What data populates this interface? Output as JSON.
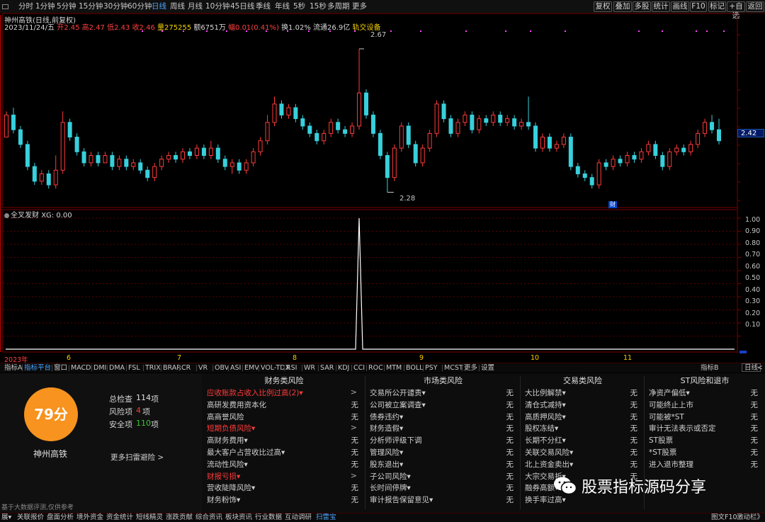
{
  "periods": [
    "分时",
    "1分钟",
    "5分钟",
    "15分钟",
    "30分钟",
    "60分钟",
    "日线",
    "周线",
    "月线",
    "10分钟",
    "45日线",
    "季线",
    "年线",
    "5秒",
    "15秒",
    "多周期",
    "更多"
  ],
  "active_period": "日线",
  "right_tools": [
    "复权",
    "叠加",
    "多股",
    "统计",
    "画线",
    "F10",
    "标记",
    "+自选",
    "返回"
  ],
  "stock_title": "神州高铁(日线,前复权)",
  "info": {
    "date": "2023/11/24/五",
    "open": "开2.45",
    "high": "高2.47",
    "low": "低2.43",
    "close": "收2.46",
    "volume": "量275255",
    "amount": "额6751万",
    "change": "幅0.01(0.41%)",
    "turnover": "换1.02%",
    "float_cap": "流通26.9亿",
    "sector": "轨交设备"
  },
  "price_tag": "2.42",
  "cai_tag": "财",
  "annotations": {
    "high": "2.67",
    "low": "2.28"
  },
  "indicator": {
    "title": "全叉发财",
    "value": "XG: 0.00"
  },
  "y_axis_indicator": [
    "1.00",
    "0.90",
    "0.80",
    "0.70",
    "0.60",
    "0.50",
    "0.40",
    "0.30",
    "0.20",
    "0.10"
  ],
  "x_dates": [
    "2023年",
    "6",
    "7",
    "8",
    "9",
    "10",
    "11"
  ],
  "indicator_tabs": [
    "指标A",
    "指标平台",
    "窗口",
    "MACD",
    "DMI",
    "DMA",
    "FSL",
    "TRIX",
    "BRAR",
    "CR",
    "VR",
    "OBV",
    "ASI",
    "EMV",
    "VOL-TDX",
    "RSI",
    "WR",
    "SAR",
    "KDJ",
    "CCI",
    "ROC",
    "MTM",
    "BOLL",
    "PSY",
    "MCST",
    "更多",
    "设置"
  ],
  "indicator_tabs_active": "指标平台",
  "indicator_right": [
    "指标B",
    "日线",
    "+",
    "<"
  ],
  "score": {
    "value": "79分",
    "company": "神州高铁",
    "total_label": "总检查",
    "total": "114",
    "total_unit": "项",
    "risk_label": "风险项",
    "risk": "4",
    "risk_unit": "项",
    "safe_label": "安全项",
    "safe": "110",
    "safe_unit": "项",
    "more": "更多扫雷避险 >"
  },
  "panel_note": "基于大数据评测,仅供参考",
  "risk_columns": [
    {
      "title": "财务类风险",
      "rows": [
        {
          "label": "应收账款占收入比例过高(2)▾",
          "status": ">",
          "hot": true
        },
        {
          "label": "高研发费用资本化",
          "status": "无",
          "hot": false
        },
        {
          "label": "高商誉风险",
          "status": "无",
          "hot": false
        },
        {
          "label": "短期负债风险▾",
          "status": ">",
          "hot": true
        },
        {
          "label": "高财务费用▾",
          "status": "无",
          "hot": false
        },
        {
          "label": "最大客户占营收比过高▾",
          "status": "无",
          "hot": false
        },
        {
          "label": "流动性风险▾",
          "status": "无",
          "hot": false
        },
        {
          "label": "财报亏损▾",
          "status": ">",
          "hot": true
        },
        {
          "label": "营收陡降风险▾",
          "status": "无",
          "hot": false
        },
        {
          "label": "财务粉饰▾",
          "status": "无",
          "hot": false
        }
      ]
    },
    {
      "title": "市场类风险",
      "rows": [
        {
          "label": "交易所公开谴责▾",
          "status": "无",
          "hot": false
        },
        {
          "label": "公司被立案调查▾",
          "status": "无",
          "hot": false
        },
        {
          "label": "债券违约▾",
          "status": "无",
          "hot": false
        },
        {
          "label": "财务造假▾",
          "status": "无",
          "hot": false
        },
        {
          "label": "分析师评级下调",
          "status": "无",
          "hot": false
        },
        {
          "label": "管理风险▾",
          "status": "无",
          "hot": false
        },
        {
          "label": "股东退出▾",
          "status": "无",
          "hot": false
        },
        {
          "label": "子公司风险▾",
          "status": "无",
          "hot": false
        },
        {
          "label": "长时间停牌▾",
          "status": "无",
          "hot": false
        },
        {
          "label": "审计报告保留意见▾",
          "status": "无",
          "hot": false
        }
      ]
    },
    {
      "title": "交易类风险",
      "rows": [
        {
          "label": "大比例解禁▾",
          "status": "无",
          "hot": false
        },
        {
          "label": "清仓式减持▾",
          "status": "无",
          "hot": false
        },
        {
          "label": "高质押风险▾",
          "status": "无",
          "hot": false
        },
        {
          "label": "股权冻结▾",
          "status": "无",
          "hot": false
        },
        {
          "label": "长期不分红▾",
          "status": "无",
          "hot": false
        },
        {
          "label": "关联交易风险▾",
          "status": "无",
          "hot": false
        },
        {
          "label": "北上资金卖出▾",
          "status": "无",
          "hot": false
        },
        {
          "label": "大宗交易折▾",
          "status": "无",
          "hot": false
        },
        {
          "label": "融券高额▾",
          "status": "",
          "hot": false
        },
        {
          "label": "换手率过高▾",
          "status": "",
          "hot": false
        }
      ]
    },
    {
      "title": "ST风险和退市",
      "rows": [
        {
          "label": "净资产偏低▾",
          "status": "无",
          "hot": false
        },
        {
          "label": "可能终止上市",
          "status": "无",
          "hot": false
        },
        {
          "label": "可能被*ST",
          "status": "无",
          "hot": false
        },
        {
          "label": "审计无法表示或否定",
          "status": "无",
          "hot": false
        },
        {
          "label": "ST股票",
          "status": "无",
          "hot": false
        },
        {
          "label": "*ST股票",
          "status": "无",
          "hot": false
        },
        {
          "label": "进入退市整理",
          "status": "无",
          "hot": false
        }
      ]
    }
  ],
  "watermark": "股票指标源码分享",
  "status_tabs": [
    "展▾",
    "关联报价",
    "盘面分析",
    "境外资金",
    "资金统计",
    "短线精灵",
    "涨跌贡献",
    "综合资讯",
    "板块资讯",
    "行业数据",
    "互动调研",
    "扫雷宝"
  ],
  "status_tabs_active": "扫雷宝",
  "status_right": [
    "图文F10",
    "激动栏》"
  ],
  "colors": {
    "up": "#ff3b3b",
    "down": "#37d0dc",
    "accent": "#4da6ff",
    "score": "#f7931e"
  },
  "chart_data": {
    "type": "candlestick",
    "note_series": "daily candles, price",
    "candles": [
      [
        2.43,
        2.49,
        2.5,
        2.43
      ],
      [
        2.49,
        2.45,
        2.51,
        2.44
      ],
      [
        2.45,
        2.41,
        2.46,
        2.4
      ],
      [
        2.41,
        2.35,
        2.42,
        2.34
      ],
      [
        2.35,
        2.31,
        2.36,
        2.3
      ],
      [
        2.31,
        2.33,
        2.34,
        2.3
      ],
      [
        2.33,
        2.3,
        2.34,
        2.29
      ],
      [
        2.3,
        2.34,
        2.38,
        2.29
      ],
      [
        2.34,
        2.47,
        2.5,
        2.33
      ],
      [
        2.47,
        2.43,
        2.48,
        2.42
      ],
      [
        2.43,
        2.39,
        2.44,
        2.38
      ],
      [
        2.39,
        2.36,
        2.4,
        2.35
      ],
      [
        2.36,
        2.38,
        2.39,
        2.35
      ],
      [
        2.38,
        2.36,
        2.39,
        2.35
      ],
      [
        2.36,
        2.38,
        2.39,
        2.36
      ],
      [
        2.38,
        2.35,
        2.39,
        2.34
      ],
      [
        2.35,
        2.37,
        2.38,
        2.34
      ],
      [
        2.37,
        2.35,
        2.38,
        2.34
      ],
      [
        2.35,
        2.36,
        2.37,
        2.34
      ],
      [
        2.36,
        2.34,
        2.37,
        2.33
      ],
      [
        2.34,
        2.32,
        2.35,
        2.31
      ],
      [
        2.32,
        2.35,
        2.36,
        2.31
      ],
      [
        2.35,
        2.37,
        2.38,
        2.34
      ],
      [
        2.37,
        2.38,
        2.39,
        2.36
      ],
      [
        2.38,
        2.37,
        2.39,
        2.36
      ],
      [
        2.37,
        2.39,
        2.4,
        2.36
      ],
      [
        2.39,
        2.38,
        2.4,
        2.37
      ],
      [
        2.38,
        2.4,
        2.41,
        2.37
      ],
      [
        2.4,
        2.38,
        2.41,
        2.37
      ],
      [
        2.38,
        2.4,
        2.42,
        2.37
      ],
      [
        2.4,
        2.37,
        2.41,
        2.36
      ],
      [
        2.37,
        2.35,
        2.38,
        2.34
      ],
      [
        2.35,
        2.36,
        2.37,
        2.33
      ],
      [
        2.36,
        2.34,
        2.37,
        2.33
      ],
      [
        2.34,
        2.36,
        2.37,
        2.33
      ],
      [
        2.36,
        2.39,
        2.4,
        2.35
      ],
      [
        2.39,
        2.42,
        2.43,
        2.38
      ],
      [
        2.42,
        2.47,
        2.49,
        2.41
      ],
      [
        2.47,
        2.52,
        2.54,
        2.46
      ],
      [
        2.52,
        2.49,
        2.53,
        2.48
      ],
      [
        2.49,
        2.51,
        2.52,
        2.48
      ],
      [
        2.51,
        2.48,
        2.52,
        2.47
      ],
      [
        2.48,
        2.46,
        2.49,
        2.45
      ],
      [
        2.46,
        2.44,
        2.47,
        2.43
      ],
      [
        2.44,
        2.42,
        2.45,
        2.41
      ],
      [
        2.42,
        2.44,
        2.45,
        2.41
      ],
      [
        2.44,
        2.47,
        2.48,
        2.43
      ],
      [
        2.47,
        2.45,
        2.48,
        2.44
      ],
      [
        2.45,
        2.44,
        2.46,
        2.43
      ],
      [
        2.44,
        2.46,
        2.47,
        2.43
      ],
      [
        2.46,
        2.55,
        2.67,
        2.45
      ],
      [
        2.55,
        2.49,
        2.56,
        2.48
      ],
      [
        2.49,
        2.44,
        2.5,
        2.43
      ],
      [
        2.44,
        2.38,
        2.45,
        2.37
      ],
      [
        2.38,
        2.32,
        2.39,
        2.28
      ],
      [
        2.32,
        2.4,
        2.41,
        2.31
      ],
      [
        2.4,
        2.46,
        2.47,
        2.39
      ],
      [
        2.46,
        2.41,
        2.47,
        2.4
      ],
      [
        2.41,
        2.36,
        2.42,
        2.35
      ],
      [
        2.36,
        2.4,
        2.41,
        2.35
      ],
      [
        2.4,
        2.44,
        2.45,
        2.39
      ],
      [
        2.44,
        2.52,
        2.53,
        2.43
      ],
      [
        2.52,
        2.48,
        2.53,
        2.47
      ],
      [
        2.48,
        2.44,
        2.49,
        2.43
      ],
      [
        2.44,
        2.47,
        2.48,
        2.43
      ],
      [
        2.47,
        2.49,
        2.5,
        2.46
      ],
      [
        2.49,
        2.45,
        2.5,
        2.44
      ],
      [
        2.45,
        2.48,
        2.49,
        2.44
      ],
      [
        2.48,
        2.47,
        2.49,
        2.46
      ],
      [
        2.47,
        2.49,
        2.5,
        2.46
      ],
      [
        2.49,
        2.47,
        2.5,
        2.46
      ],
      [
        2.47,
        2.48,
        2.49,
        2.46
      ],
      [
        2.48,
        2.46,
        2.49,
        2.45
      ],
      [
        2.46,
        2.47,
        2.48,
        2.45
      ],
      [
        2.47,
        2.46,
        2.54,
        2.45
      ],
      [
        2.46,
        2.4,
        2.47,
        2.39
      ],
      [
        2.4,
        2.43,
        2.44,
        2.39
      ],
      [
        2.43,
        2.4,
        2.44,
        2.39
      ],
      [
        2.4,
        2.41,
        2.42,
        2.39
      ],
      [
        2.41,
        2.43,
        2.44,
        2.4
      ],
      [
        2.43,
        2.35,
        2.44,
        2.34
      ],
      [
        2.35,
        2.33,
        2.36,
        2.32
      ],
      [
        2.33,
        2.32,
        2.34,
        2.31
      ],
      [
        2.32,
        2.3,
        2.33,
        2.29
      ],
      [
        2.3,
        2.36,
        2.37,
        2.29
      ],
      [
        2.36,
        2.35,
        2.37,
        2.34
      ],
      [
        2.35,
        2.37,
        2.38,
        2.34
      ],
      [
        2.37,
        2.36,
        2.38,
        2.35
      ],
      [
        2.36,
        2.38,
        2.39,
        2.35
      ],
      [
        2.38,
        2.37,
        2.39,
        2.36
      ],
      [
        2.37,
        2.39,
        2.4,
        2.36
      ],
      [
        2.39,
        2.41,
        2.42,
        2.38
      ],
      [
        2.41,
        2.38,
        2.42,
        2.37
      ],
      [
        2.38,
        2.35,
        2.39,
        2.34
      ],
      [
        2.35,
        2.39,
        2.4,
        2.34
      ],
      [
        2.39,
        2.4,
        2.41,
        2.38
      ],
      [
        2.4,
        2.39,
        2.41,
        2.38
      ],
      [
        2.39,
        2.41,
        2.42,
        2.38
      ],
      [
        2.41,
        2.44,
        2.45,
        2.4
      ],
      [
        2.44,
        2.47,
        2.48,
        2.43
      ],
      [
        2.47,
        2.45,
        2.49,
        2.44
      ],
      [
        2.45,
        2.42,
        2.48,
        2.41
      ]
    ],
    "ylim": [
      2.25,
      2.72
    ],
    "indicator_series": "XG",
    "indicator_spike_index": 50,
    "indicator_ylim": [
      0,
      1.05
    ]
  }
}
